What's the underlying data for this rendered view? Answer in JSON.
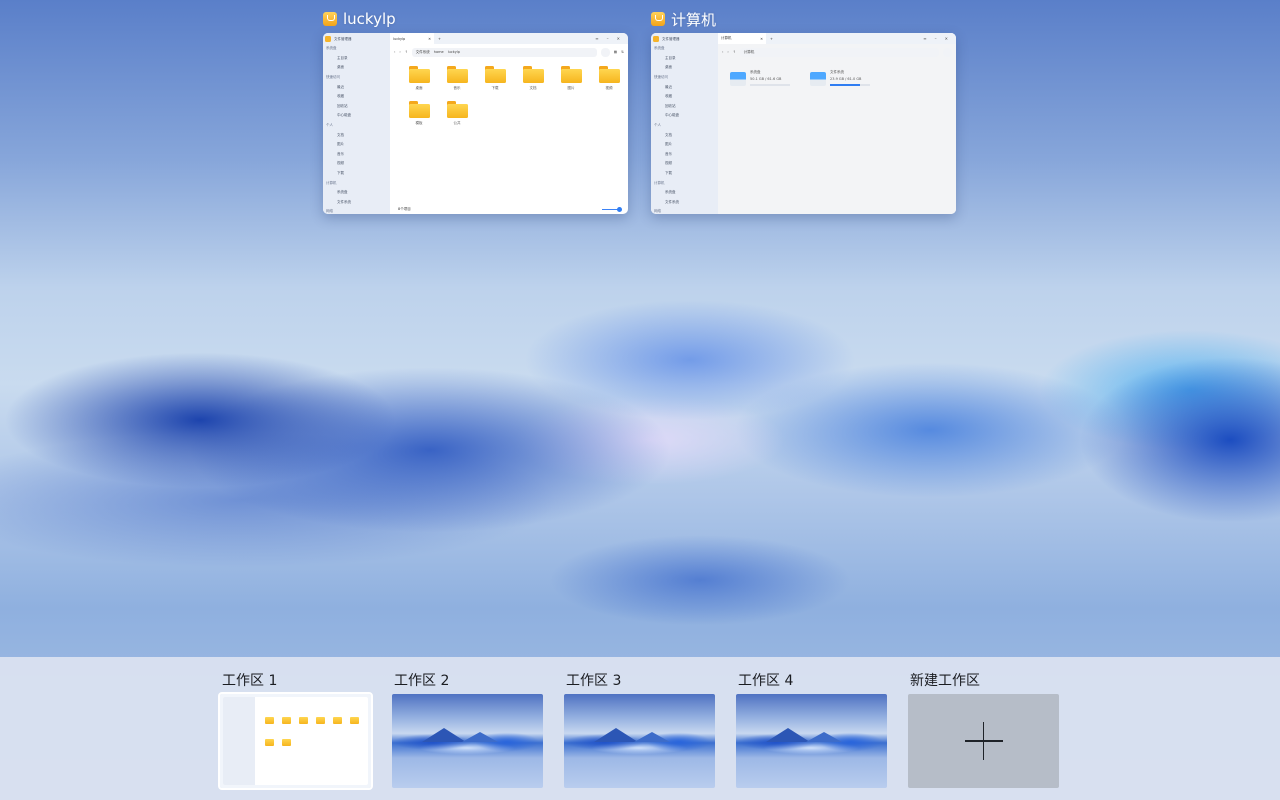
{
  "windows": [
    {
      "title": "luckylp",
      "app": "文件管理器",
      "tab_label": "luckylp",
      "breadcrumb": [
        "文件系统",
        "home",
        "luckylp"
      ],
      "sidebar": {
        "groups": [
          {
            "label": "系统盘",
            "items": [
              "主目录",
              "桌面"
            ]
          },
          {
            "label": "快速访问",
            "items": [
              "最近",
              "收藏",
              "回收站",
              "中心磁盘"
            ]
          },
          {
            "label": "个人",
            "items": [
              "文档",
              "图片",
              "音乐",
              "视频",
              "下载"
            ]
          },
          {
            "label": "计算机",
            "items": [
              "系统盘",
              "文件系统"
            ]
          },
          {
            "label": "网络",
            "items": []
          }
        ]
      },
      "folders": [
        "桌面",
        "音乐",
        "下载",
        "文档",
        "图片",
        "视频",
        "模板",
        "公共"
      ],
      "status_text": "8个项目"
    },
    {
      "title": "计算机",
      "app": "文件管理器",
      "tab_label": "计算机",
      "breadcrumb": [
        "计算机"
      ],
      "drives": [
        {
          "name": "系统盘",
          "detail": "50.1 GB / 61.6 GB",
          "used_fraction": 0.0
        },
        {
          "name": "文件系统",
          "detail": "23.9 GB / 61.0 GB",
          "used_fraction": 0.75
        }
      ]
    }
  ],
  "workspaces": [
    {
      "label": "工作区 1",
      "active": true
    },
    {
      "label": "工作区 2",
      "active": false
    },
    {
      "label": "工作区 3",
      "active": false
    },
    {
      "label": "工作区 4",
      "active": false
    }
  ],
  "new_workspace_label": "新建工作区",
  "colors": {
    "accent": "#2f7df2",
    "folder": "#f6b51e",
    "workspace_bar": "#dae2f0"
  }
}
